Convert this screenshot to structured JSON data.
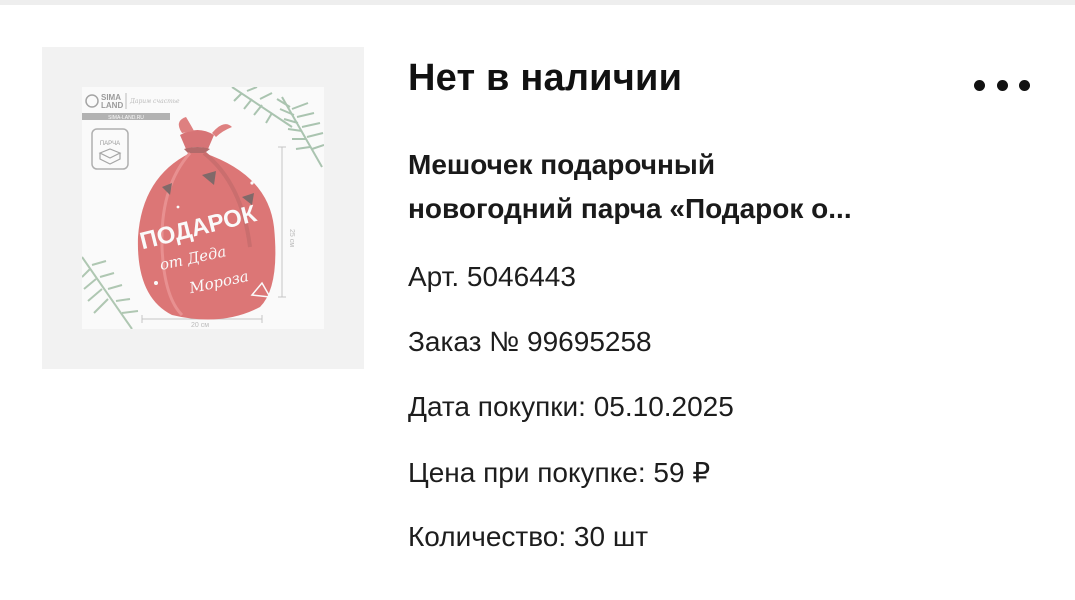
{
  "product": {
    "status": "Нет в наличии",
    "title_line1": "Мешочек подарочный",
    "title_line2": "новогодний парча «Подарок о...",
    "article": "Арт. 5046443",
    "order": "Заказ № 99695258",
    "purchase_date": "Дата покупки: 05.10.2025",
    "price": "Цена при покупке: 59 ₽",
    "quantity": "Количество: 30 шт"
  },
  "image": {
    "brand_line1": "SIMA",
    "brand_line2": "LAND",
    "brand_tagline": "Дарим счастье",
    "brand_bar": "SIMA-LAND.RU",
    "material_label": "ПАРЧА",
    "bag_text_1": "ПОДАРОК",
    "bag_text_2": "от Деда",
    "bag_text_3": "Мороза",
    "dim_width": "20 см",
    "dim_height": "25 см"
  },
  "icons": {
    "more": "more-horizontal-icon",
    "package": "package-icon"
  },
  "colors": {
    "status_text": "#111111",
    "body_text": "#1d1d1d",
    "thumb_bg": "#f2f2f2",
    "bag_red": "#cf2b2b"
  }
}
